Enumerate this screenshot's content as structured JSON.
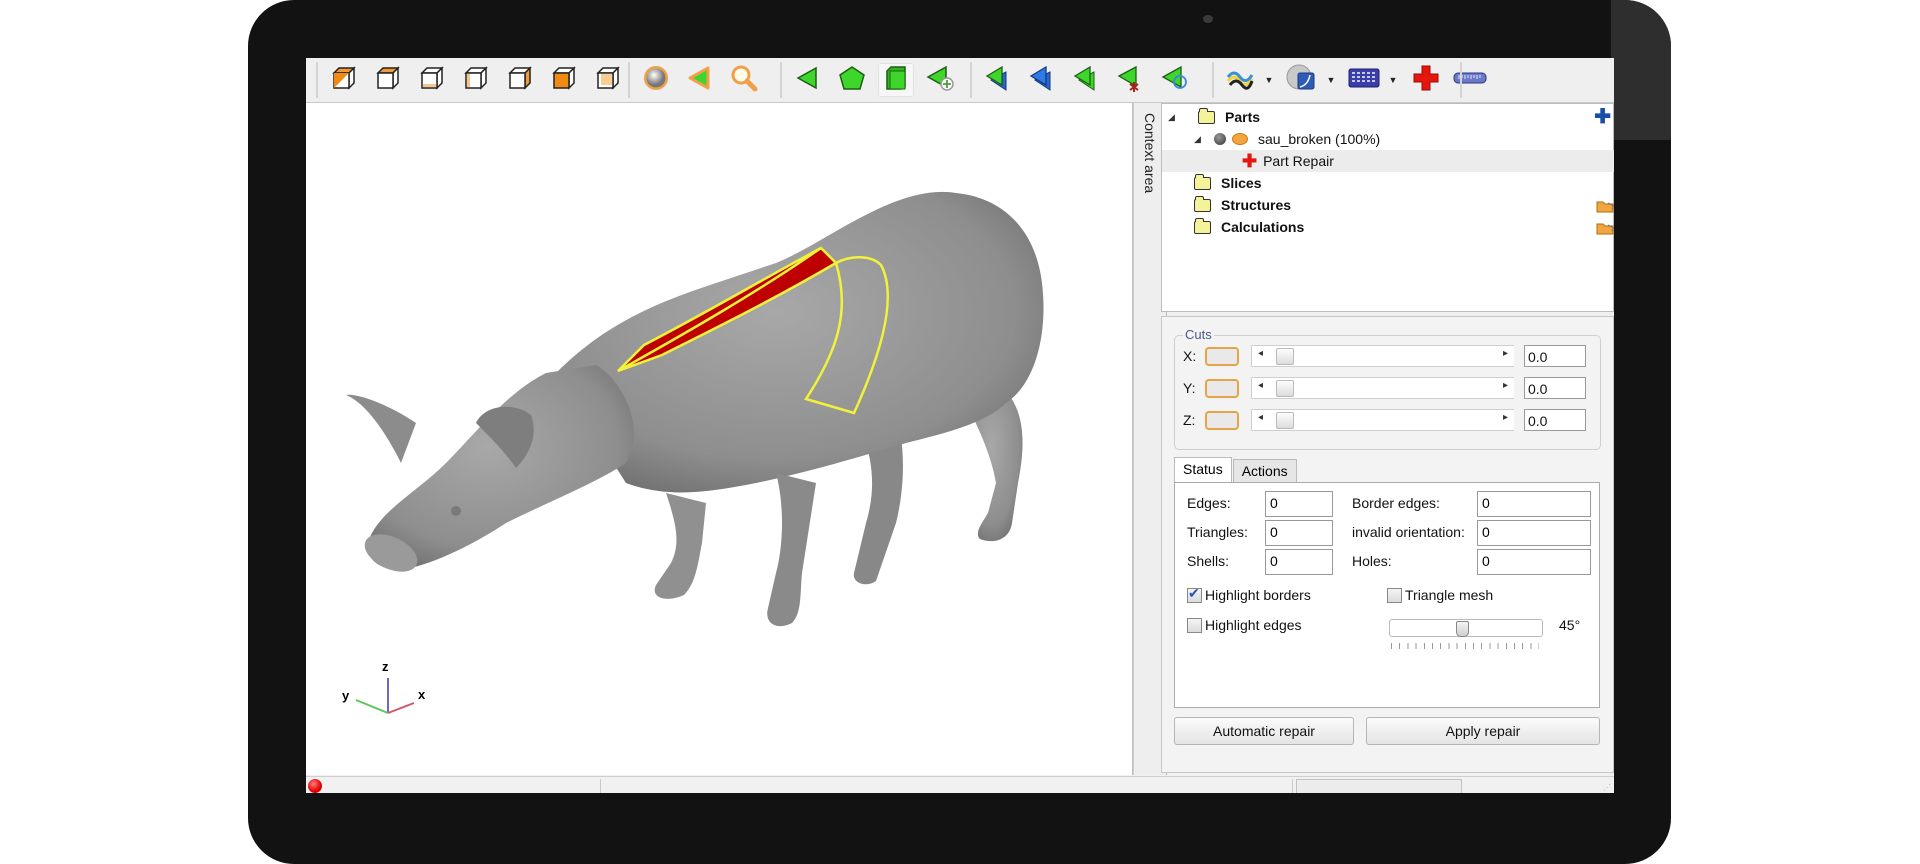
{
  "toolbar": {
    "view_group": [
      {
        "name": "view-iso-icon",
        "title": "Isometric view"
      },
      {
        "name": "view-top-icon",
        "title": "Top view"
      },
      {
        "name": "view-bottom-icon",
        "title": "Bottom view"
      },
      {
        "name": "view-left-icon",
        "title": "Left view"
      },
      {
        "name": "view-right-icon",
        "title": "Right view"
      },
      {
        "name": "view-front-icon",
        "title": "Front view"
      },
      {
        "name": "view-back-icon",
        "title": "Back view"
      }
    ],
    "tools_group": [
      {
        "name": "shading-sphere-icon"
      },
      {
        "name": "select-triangle-icon"
      },
      {
        "name": "zoom-magnifier-icon"
      }
    ],
    "selection_group": [
      {
        "name": "select-triangle-green-icon"
      },
      {
        "name": "select-surface-icon"
      },
      {
        "name": "select-shell-icon",
        "active": true
      },
      {
        "name": "select-add-triangle-icon"
      }
    ],
    "edit_group": [
      {
        "name": "triangle-stack-blue-icon"
      },
      {
        "name": "triangle-blue-icon"
      },
      {
        "name": "triangle-duplicate-icon"
      },
      {
        "name": "triangle-delete-star-icon"
      },
      {
        "name": "triangle-circle-icon"
      }
    ],
    "misc_group": [
      {
        "name": "curves-icon",
        "dropdown": true
      },
      {
        "name": "surface-view-icon",
        "dropdown": true
      },
      {
        "name": "keyboard-grid-icon",
        "dropdown": true
      },
      {
        "name": "repair-cross-icon"
      },
      {
        "name": "ruler-icon"
      }
    ]
  },
  "viewport": {
    "axes": {
      "x": "x",
      "y": "y",
      "z": "z"
    },
    "model": "pig mesh with highlighted hole",
    "colors": {
      "mesh": "#8f8f8f",
      "hole": "#b00000",
      "border": "#f2f23a"
    }
  },
  "context_area": {
    "label": "Context area"
  },
  "tree": {
    "items": [
      {
        "label": "Parts",
        "bold": true,
        "level": 0,
        "actions": [
          "add"
        ]
      },
      {
        "label": "sau_broken (100%)",
        "bold": false,
        "level": 1,
        "actions": [
          "remove"
        ]
      },
      {
        "label": "Part Repair",
        "bold": false,
        "level": 2,
        "selected": true,
        "actions": [
          "confirm",
          "remove"
        ]
      },
      {
        "label": "Slices",
        "bold": true,
        "level": 0,
        "actions": [
          "open"
        ]
      },
      {
        "label": "Structures",
        "bold": true,
        "level": 0,
        "actions": [
          "open",
          "add"
        ]
      },
      {
        "label": "Calculations",
        "bold": true,
        "level": 0,
        "actions": [
          "open",
          "add"
        ]
      }
    ]
  },
  "cuts": {
    "legend": "Cuts",
    "rows": [
      {
        "label": "X:",
        "value": "0.0"
      },
      {
        "label": "Y:",
        "value": "0.0"
      },
      {
        "label": "Z:",
        "value": "0.0"
      }
    ]
  },
  "tabs": [
    {
      "label": "Status",
      "active": true
    },
    {
      "label": "Actions",
      "active": false
    }
  ],
  "status": {
    "edges_label": "Edges:",
    "edges": "0",
    "triangles_label": "Triangles:",
    "triangles": "0",
    "shells_label": "Shells:",
    "shells": "0",
    "border_edges_label": "Border edges:",
    "border_edges": "0",
    "invalid_orientation_label": "invalid orientation:",
    "invalid_orientation": "0",
    "holes_label": "Holes:",
    "holes": "0",
    "highlight_borders": {
      "label": "Highlight borders",
      "checked": true
    },
    "triangle_mesh": {
      "label": "Triangle mesh",
      "checked": false
    },
    "highlight_edges": {
      "label": "Highlight edges",
      "checked": false
    },
    "angle": {
      "value_label": "45°",
      "value": 45
    }
  },
  "buttons": {
    "automatic_repair": "Automatic repair",
    "apply_repair": "Apply repair"
  }
}
